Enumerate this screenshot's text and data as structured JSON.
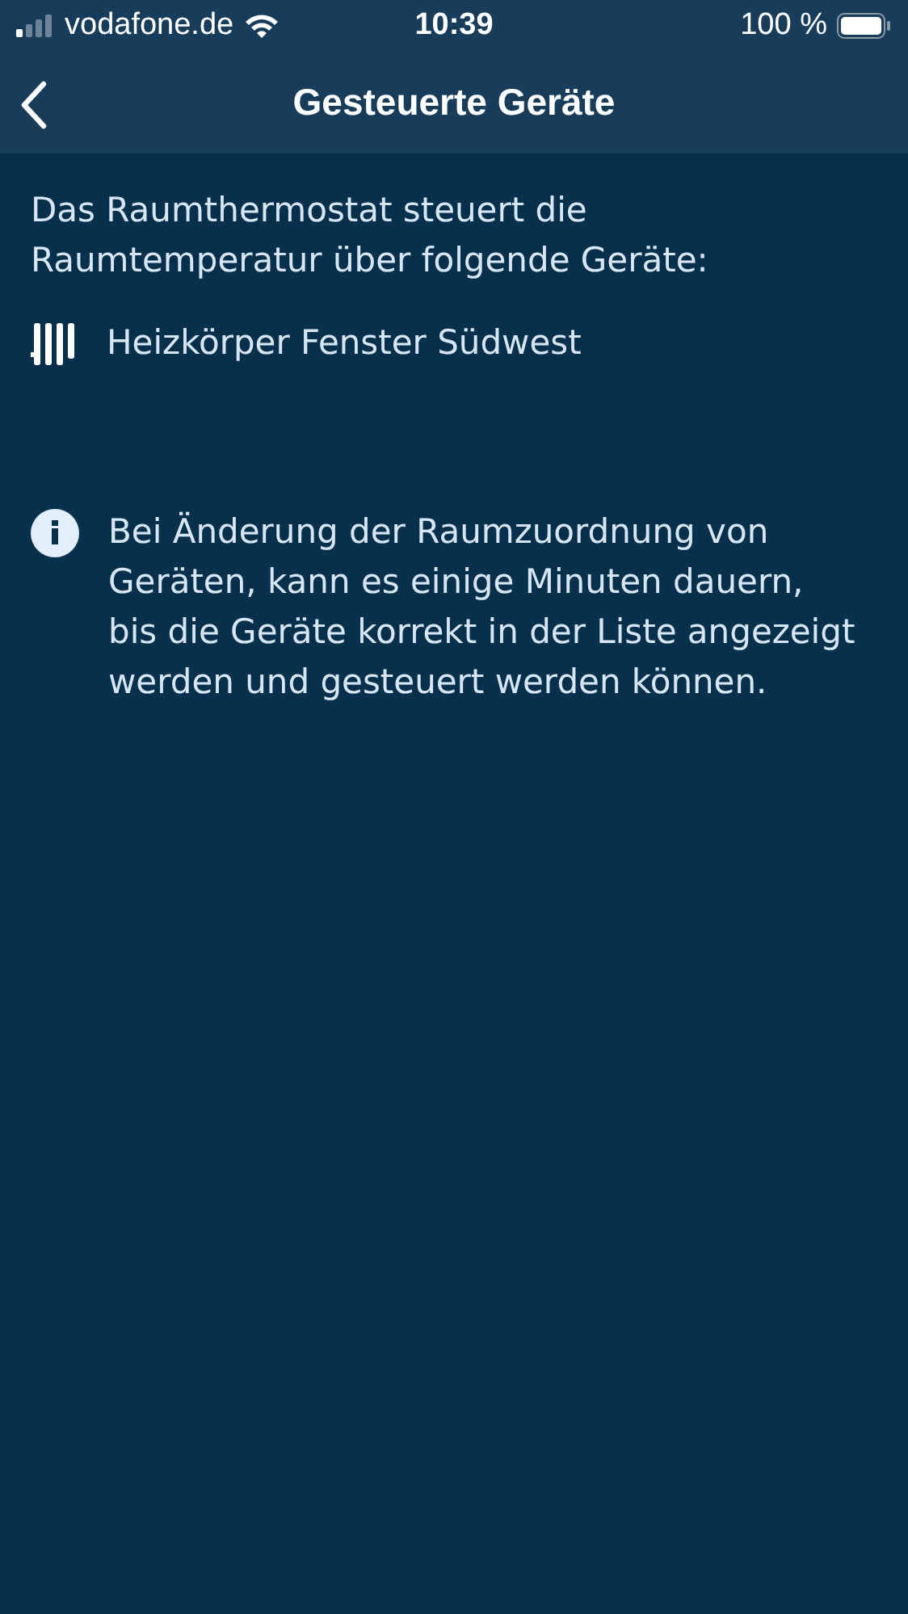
{
  "status_bar": {
    "carrier": "vodafone.de",
    "time": "10:39",
    "battery": "100 %"
  },
  "nav": {
    "title": "Gesteuerte Geräte"
  },
  "intro": "Das Raumthermostat steuert die Raumtemperatur über folgende Geräte:",
  "devices": [
    {
      "name": "Heizkörper Fenster Südwest",
      "kind": "radiator"
    }
  ],
  "info": "Bei Änderung der Raumzuordnung von Geräten, kann es einige Minuten dauern, bis die Geräte korrekt in der Liste angezeigt werden und gesteuert werden können."
}
